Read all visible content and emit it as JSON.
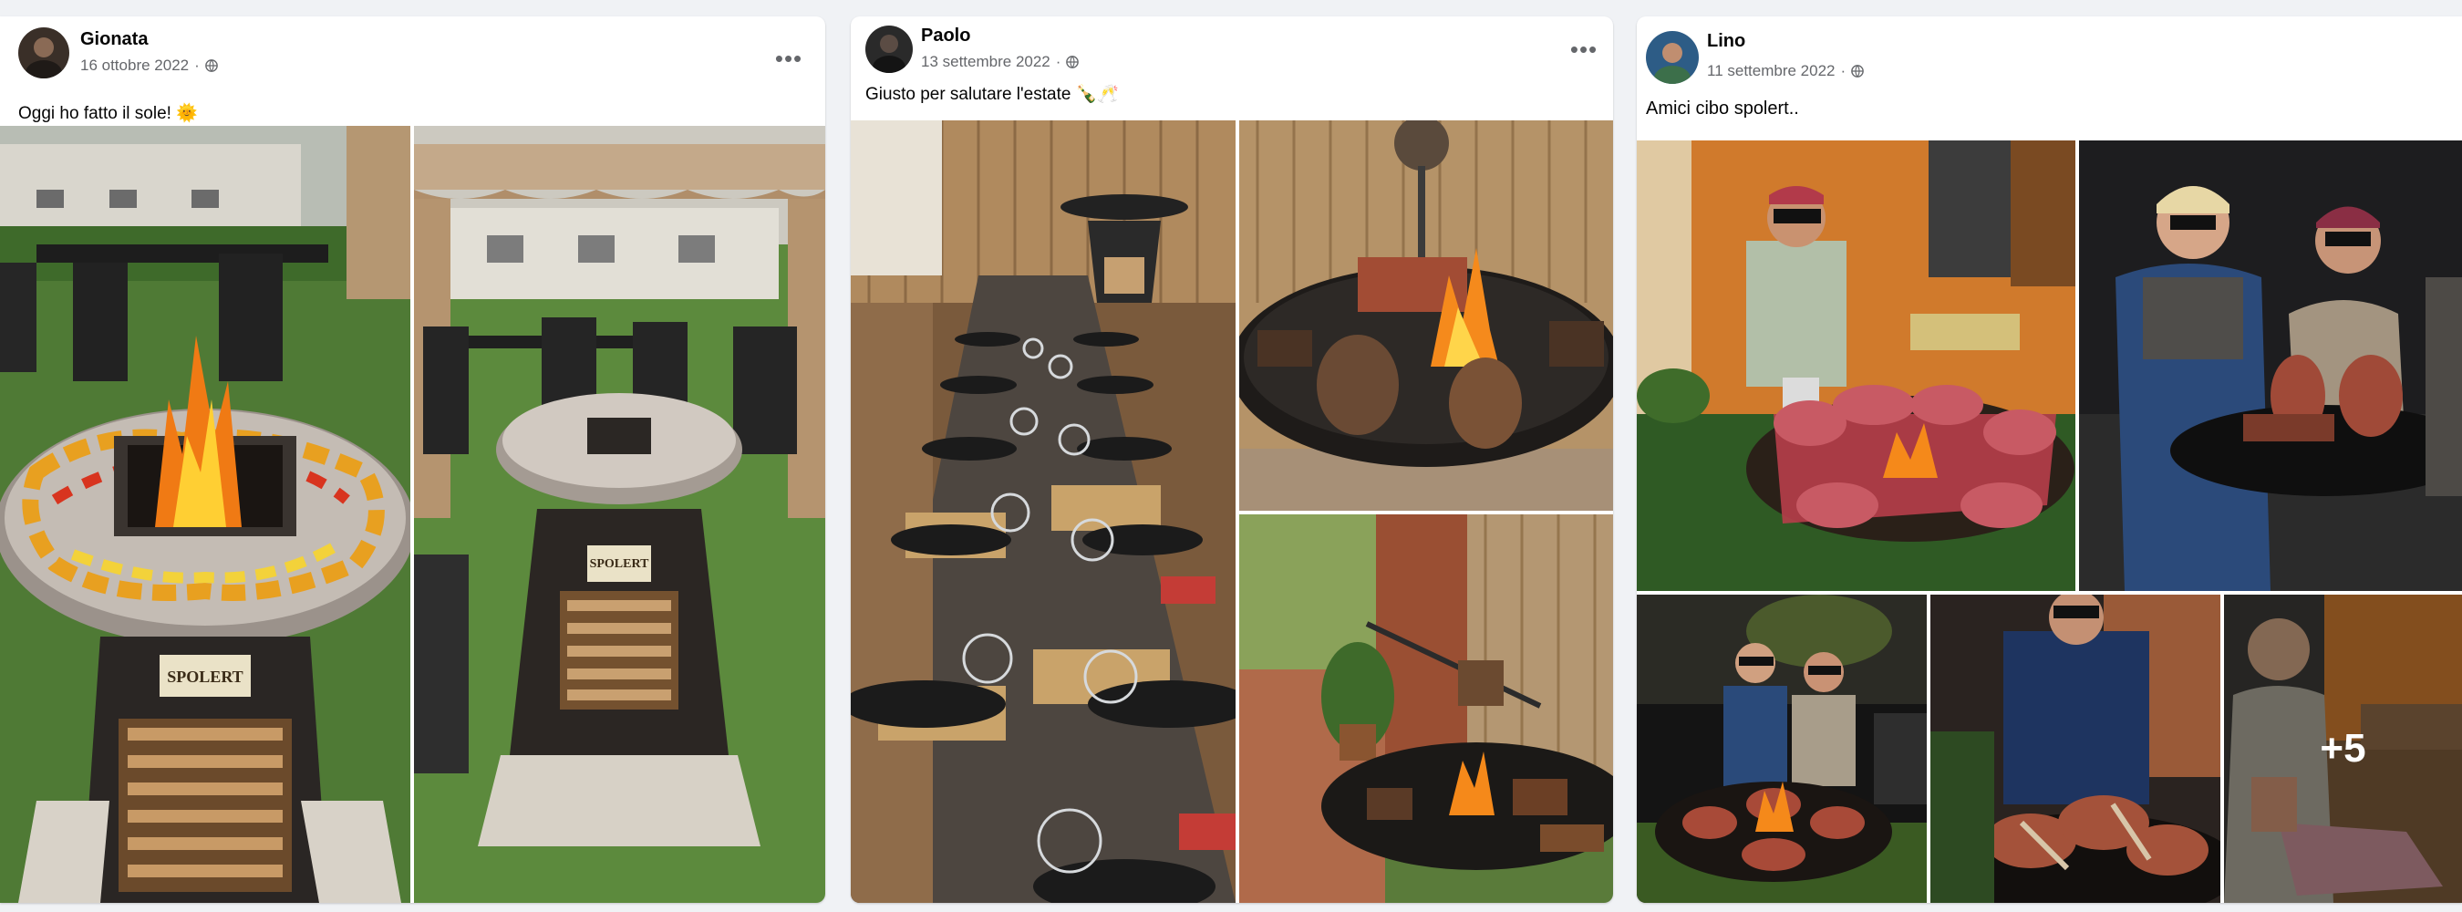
{
  "posts": [
    {
      "author": "Gionata",
      "date": "16 ottobre 2022",
      "separator": "·",
      "caption": "Oggi ho fatto il sole! 🌞",
      "photo_labels": [
        "SPOLERT",
        "SPOLERT"
      ]
    },
    {
      "author": "Paolo",
      "date": "13 settembre 2022",
      "separator": "·",
      "caption": "Giusto per salutare l'estate 🍾🥂"
    },
    {
      "author": "Lino",
      "date": "11 settembre 2022",
      "separator": "·",
      "caption": "Amici cibo spolert..",
      "more_photos": "+5"
    }
  ],
  "more_icon": "more-horizontal-icon",
  "privacy_icon": "globe-icon",
  "colors": {
    "background": "#f0f2f5",
    "card": "#ffffff",
    "text_primary": "#050505",
    "text_secondary": "#65676b"
  }
}
